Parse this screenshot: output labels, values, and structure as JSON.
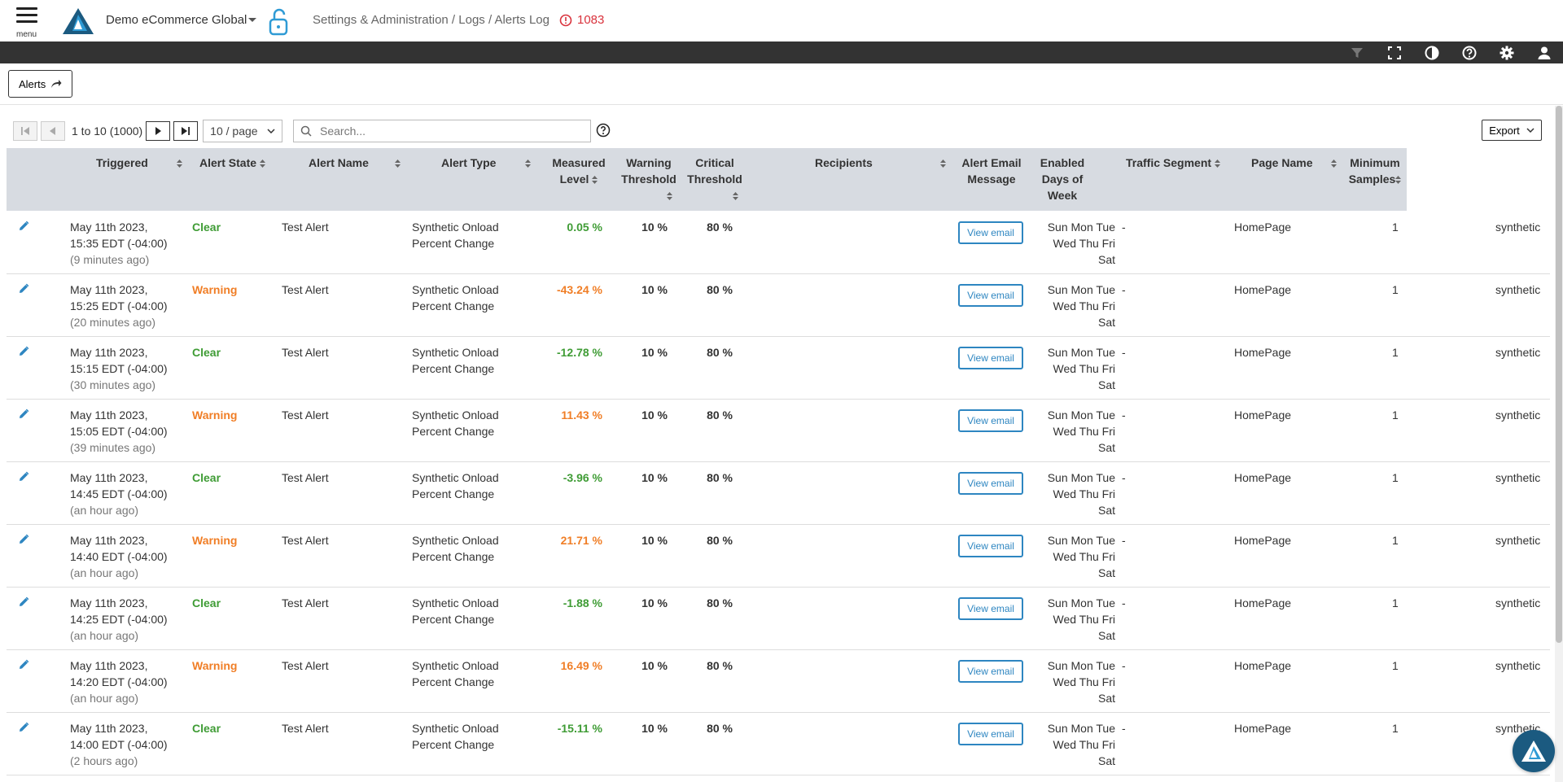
{
  "header": {
    "menu_label": "menu",
    "org_name": "Demo eCommerce Global",
    "breadcrumb": "Settings & Administration / Logs / Alerts Log",
    "alert_count": "1083"
  },
  "toolbar": {
    "icons": [
      "filter-icon",
      "fullscreen-icon",
      "contrast-icon",
      "help-icon",
      "gear-icon",
      "user-icon"
    ]
  },
  "alerts_button": {
    "label": "Alerts"
  },
  "pagination": {
    "range_label": "1 to 10 (1000)",
    "per_page": "10 / page",
    "search_placeholder": "Search..."
  },
  "export": {
    "label": "Export"
  },
  "table": {
    "columns": {
      "triggered": "Triggered",
      "alert_state": "Alert State",
      "alert_name": "Alert Name",
      "alert_type": "Alert Type",
      "measured_level_1": "Measured",
      "measured_level_2": "Level",
      "warning_threshold_1": "Warning",
      "warning_threshold_2": "Threshold",
      "critical_threshold_1": "Critical",
      "critical_threshold_2": "Threshold",
      "recipients": "Recipients",
      "alert_email_1": "Alert Email",
      "alert_email_2": "Message",
      "enabled_days_1": "Enabled",
      "enabled_days_2": "Days of",
      "enabled_days_3": "Week",
      "traffic_segment": "Traffic Segment",
      "page_name": "Page Name",
      "min_samples_1": "Minimum",
      "min_samples_2": "Samples"
    },
    "rows": [
      {
        "date": "May 11th 2023,",
        "time": "15:35 EDT (-04:00)",
        "ago": "(9 minutes ago)",
        "state": "Clear",
        "name": "Test Alert",
        "type1": "Synthetic Onload",
        "type2": "Percent Change",
        "measured": "0.05 %",
        "warning": "10 %",
        "critical": "80 %",
        "email": "View email",
        "days1": "Sun Mon Tue",
        "days2": "Wed Thu Fri",
        "days3": "Sat",
        "segment": "-",
        "page": "HomePage",
        "samples": "1",
        "source": "synthetic"
      },
      {
        "date": "May 11th 2023,",
        "time": "15:25 EDT (-04:00)",
        "ago": "(20 minutes ago)",
        "state": "Warning",
        "name": "Test Alert",
        "type1": "Synthetic Onload",
        "type2": "Percent Change",
        "measured": "-43.24 %",
        "warning": "10 %",
        "critical": "80 %",
        "email": "View email",
        "days1": "Sun Mon Tue",
        "days2": "Wed Thu Fri",
        "days3": "Sat",
        "segment": "-",
        "page": "HomePage",
        "samples": "1",
        "source": "synthetic"
      },
      {
        "date": "May 11th 2023,",
        "time": "15:15 EDT (-04:00)",
        "ago": "(30 minutes ago)",
        "state": "Clear",
        "name": "Test Alert",
        "type1": "Synthetic Onload",
        "type2": "Percent Change",
        "measured": "-12.78 %",
        "warning": "10 %",
        "critical": "80 %",
        "email": "View email",
        "days1": "Sun Mon Tue",
        "days2": "Wed Thu Fri",
        "days3": "Sat",
        "segment": "-",
        "page": "HomePage",
        "samples": "1",
        "source": "synthetic"
      },
      {
        "date": "May 11th 2023,",
        "time": "15:05 EDT (-04:00)",
        "ago": "(39 minutes ago)",
        "state": "Warning",
        "name": "Test Alert",
        "type1": "Synthetic Onload",
        "type2": "Percent Change",
        "measured": "11.43 %",
        "warning": "10 %",
        "critical": "80 %",
        "email": "View email",
        "days1": "Sun Mon Tue",
        "days2": "Wed Thu Fri",
        "days3": "Sat",
        "segment": "-",
        "page": "HomePage",
        "samples": "1",
        "source": "synthetic"
      },
      {
        "date": "May 11th 2023,",
        "time": "14:45 EDT (-04:00)",
        "ago": "(an hour ago)",
        "state": "Clear",
        "name": "Test Alert",
        "type1": "Synthetic Onload",
        "type2": "Percent Change",
        "measured": "-3.96 %",
        "warning": "10 %",
        "critical": "80 %",
        "email": "View email",
        "days1": "Sun Mon Tue",
        "days2": "Wed Thu Fri",
        "days3": "Sat",
        "segment": "-",
        "page": "HomePage",
        "samples": "1",
        "source": "synthetic"
      },
      {
        "date": "May 11th 2023,",
        "time": "14:40 EDT (-04:00)",
        "ago": "(an hour ago)",
        "state": "Warning",
        "name": "Test Alert",
        "type1": "Synthetic Onload",
        "type2": "Percent Change",
        "measured": "21.71 %",
        "warning": "10 %",
        "critical": "80 %",
        "email": "View email",
        "days1": "Sun Mon Tue",
        "days2": "Wed Thu Fri",
        "days3": "Sat",
        "segment": "-",
        "page": "HomePage",
        "samples": "1",
        "source": "synthetic"
      },
      {
        "date": "May 11th 2023,",
        "time": "14:25 EDT (-04:00)",
        "ago": "(an hour ago)",
        "state": "Clear",
        "name": "Test Alert",
        "type1": "Synthetic Onload",
        "type2": "Percent Change",
        "measured": "-1.88 %",
        "warning": "10 %",
        "critical": "80 %",
        "email": "View email",
        "days1": "Sun Mon Tue",
        "days2": "Wed Thu Fri",
        "days3": "Sat",
        "segment": "-",
        "page": "HomePage",
        "samples": "1",
        "source": "synthetic"
      },
      {
        "date": "May 11th 2023,",
        "time": "14:20 EDT (-04:00)",
        "ago": "(an hour ago)",
        "state": "Warning",
        "name": "Test Alert",
        "type1": "Synthetic Onload",
        "type2": "Percent Change",
        "measured": "16.49 %",
        "warning": "10 %",
        "critical": "80 %",
        "email": "View email",
        "days1": "Sun Mon Tue",
        "days2": "Wed Thu Fri",
        "days3": "Sat",
        "segment": "-",
        "page": "HomePage",
        "samples": "1",
        "source": "synthetic"
      },
      {
        "date": "May 11th 2023,",
        "time": "14:00 EDT (-04:00)",
        "ago": "(2 hours ago)",
        "state": "Clear",
        "name": "Test Alert",
        "type1": "Synthetic Onload",
        "type2": "Percent Change",
        "measured": "-15.11 %",
        "warning": "10 %",
        "critical": "80 %",
        "email": "View email",
        "days1": "Sun Mon Tue",
        "days2": "Wed Thu Fri",
        "days3": "Sat",
        "segment": "-",
        "page": "HomePage",
        "samples": "1",
        "source": "synthetic"
      }
    ]
  },
  "colors": {
    "clear": "#3f9c35",
    "warning": "#f07e26",
    "alert_red": "#d9323c",
    "link_blue": "#2e86c1",
    "toolbar_bg": "#333333",
    "header_bg": "#d7dbe1"
  }
}
